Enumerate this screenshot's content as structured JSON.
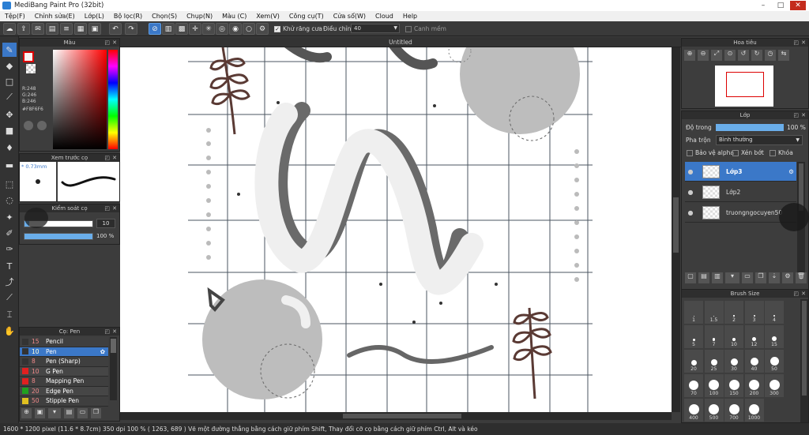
{
  "titlebar": {
    "title": "MediBang Paint Pro (32bit)",
    "min": "–",
    "max": "□",
    "close": "✕"
  },
  "menu": [
    "Tệp(F)",
    "Chỉnh sửa(E)",
    "Lớp(L)",
    "Bộ lọc(R)",
    "Chọn(S)",
    "Chụp(N)",
    "Màu (C)",
    "Xem(V)",
    "Công cụ(T)",
    "Cửa sổ(W)",
    "Cloud",
    "Help"
  ],
  "toolbar": {
    "antialias_label": "Khử răng cưa",
    "correction_label": "Điều chỉnh",
    "correction_value": "40",
    "edge_label": "Canh mềm"
  },
  "document": {
    "tab_title": "Untitled"
  },
  "color_panel": {
    "title": "Màu",
    "r": "R:248",
    "g": "G:246",
    "b": "B:246",
    "hex": "#F8F6F6",
    "accent": "#3b78c8"
  },
  "brush_preview": {
    "title": "Xem trước cọ",
    "size": "* 0.73mm"
  },
  "brush_control": {
    "title": "Kiểm soát cọ",
    "size_value": "10",
    "opacity_value": "100 %",
    "size_fraction": 0.0667,
    "opacity_fraction": 1.0
  },
  "brush_list": {
    "title": "Cọ: Pen",
    "items": [
      {
        "size": "15",
        "name": "Pencil",
        "color": "#333333",
        "selected": false
      },
      {
        "size": "10",
        "name": "Pen",
        "color": "#333333",
        "selected": true
      },
      {
        "size": "8",
        "name": "Pen (Sharp)",
        "color": "#333333",
        "selected": false
      },
      {
        "size": "10",
        "name": "G Pen",
        "color": "#e02020",
        "selected": false
      },
      {
        "size": "8",
        "name": "Mapping Pen",
        "color": "#e02020",
        "selected": false
      },
      {
        "size": "20",
        "name": "Edge Pen",
        "color": "#20a020",
        "selected": false
      },
      {
        "size": "50",
        "name": "Stipple Pen",
        "color": "#e0c020",
        "selected": false
      }
    ]
  },
  "navigator": {
    "title": "Hoa tiêu"
  },
  "layers": {
    "title": "Lớp",
    "opacity_label": "Độ trong",
    "opacity_value": "100 %",
    "opacity_fraction": 1.0,
    "blend_label": "Pha trộn",
    "blend_value": "Bình thường",
    "protect_alpha": "Bảo vệ alpha",
    "clipping": "Xén bớt",
    "lock": "Khóa",
    "items": [
      {
        "name": "Lớp3",
        "selected": true
      },
      {
        "name": "Lớp2",
        "selected": false
      },
      {
        "name": "truongngocuyen50",
        "selected": false
      }
    ]
  },
  "brush_size": {
    "title": "Brush Size",
    "sizes": [
      "1",
      "1.5",
      "2",
      "3",
      "4",
      "5",
      "7",
      "10",
      "12",
      "15",
      "20",
      "25",
      "30",
      "40",
      "50",
      "70",
      "100",
      "150",
      "200",
      "300",
      "400",
      "500",
      "700",
      "1000"
    ]
  },
  "status": {
    "text": "1600 * 1200 pixel   (11.6 * 8.7cm)   350 dpi   100 %   ( 1263, 689 )   Vẽ một đường thẳng bằng cách giữ phím Shift, Thay đổi cỡ cọ bằng cách giữ phím Ctrl, Alt và kéo"
  }
}
